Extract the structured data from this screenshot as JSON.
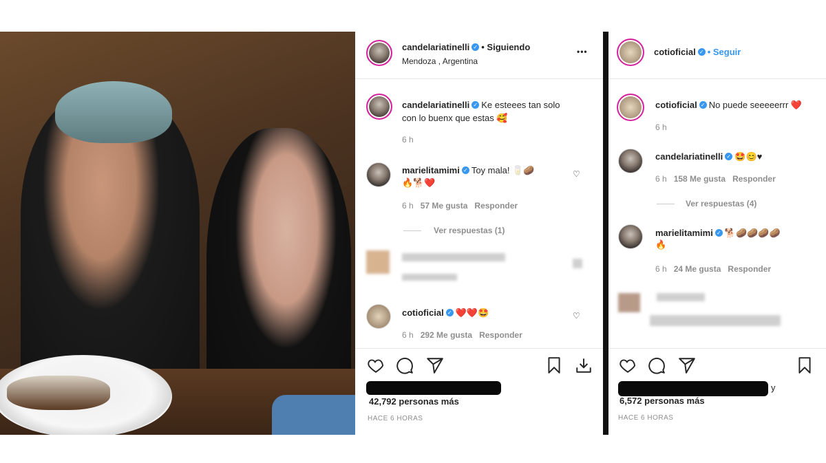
{
  "post1": {
    "header": {
      "username": "candelariatinelli",
      "follow_label": "• Siguiendo",
      "location": "Mendoza , Argentina",
      "more": "•••"
    },
    "caption": {
      "username": "candelariatinelli",
      "text_line1": "Ke esteees tan solo",
      "text_line2": "con lo buenx que estas 🥰",
      "time": "6 h"
    },
    "comments": [
      {
        "username": "marielitamimi",
        "text_line1": "Toy mala! 🥛🥔",
        "text_line2": "🔥🐕❤️",
        "time": "6 h",
        "likes": "57 Me gusta",
        "reply": "Responder",
        "replies": "Ver respuestas (1)"
      },
      {
        "username": "cotioficial",
        "text_line1": "❤️❤️🤩",
        "time": "6 h",
        "likes": "292 Me gusta",
        "reply": "Responder"
      }
    ],
    "likes_text": "42,792 personas más",
    "timestamp": "HACE 6 HORAS"
  },
  "post2": {
    "header": {
      "username": "cotioficial",
      "follow_label": "• Seguir"
    },
    "caption": {
      "username": "cotioficial",
      "text": "No puede seeeeerrr ❤️",
      "time": "6 h"
    },
    "comments": [
      {
        "username": "candelariatinelli",
        "text": "🤩😊♥",
        "time": "6 h",
        "likes": "158 Me gusta",
        "reply": "Responder",
        "replies": "Ver respuestas (4)"
      },
      {
        "username": "marielitamimi",
        "text_line1": "🐕🥔🥔🥔🥔",
        "text_line2": "🔥",
        "time": "6 h",
        "likes": "24 Me gusta",
        "reply": "Responder"
      }
    ],
    "likes_suffix": "y",
    "likes_text": "6,572 personas más",
    "timestamp": "HACE 6 HORAS"
  },
  "colors": {
    "accent": "#3897f0",
    "text": "#262626",
    "meta": "#8e8e8e",
    "heart": "#ed4956"
  }
}
